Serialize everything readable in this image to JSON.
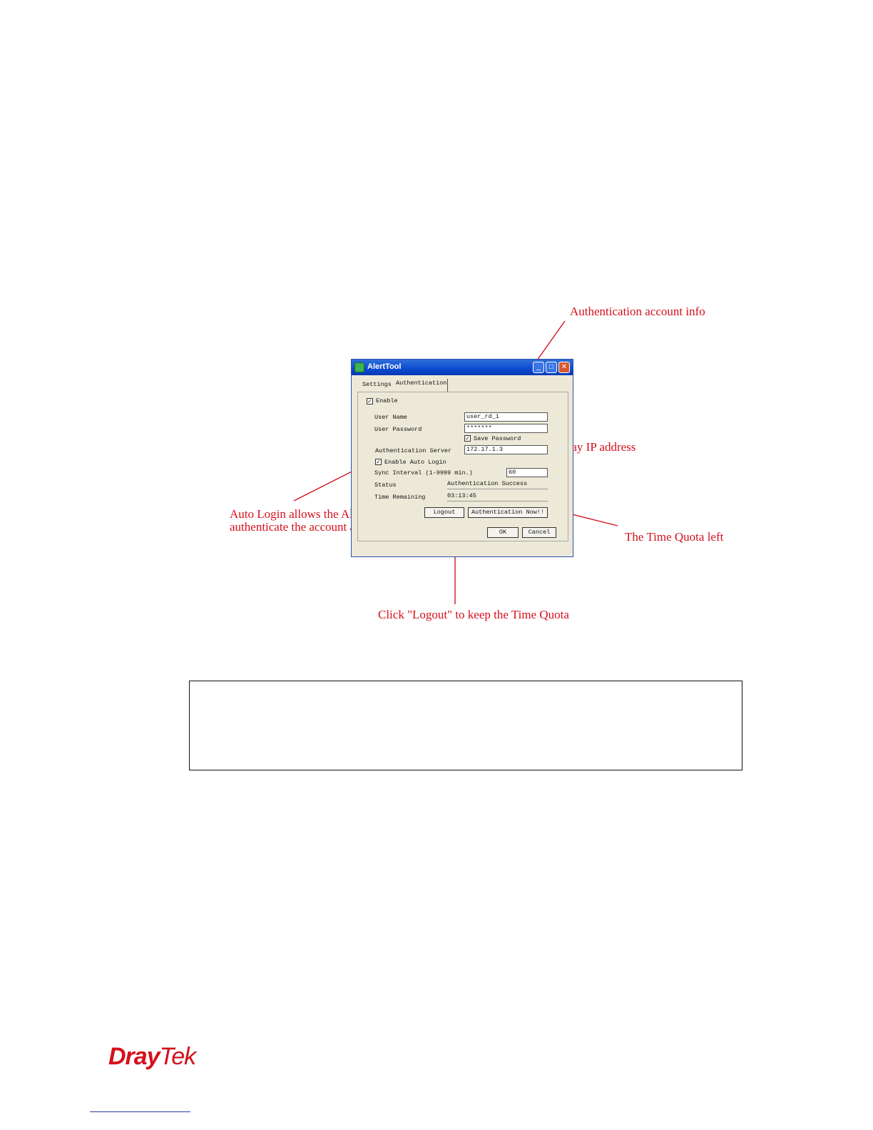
{
  "window": {
    "title": "AlertTool",
    "tabs": [
      "Settings",
      "Authentication"
    ],
    "enable_label": "Enable",
    "user_name_label": "User Name",
    "user_name_value": "user_rd_1",
    "user_password_label": "User Password",
    "user_password_value": "*******",
    "save_password_label": "Save Password",
    "auth_server_label": "Authentication Server",
    "auth_server_value": "172.17.1.3",
    "auto_login_label": "Enable Auto Login",
    "sync_interval_label": "Sync Interval (1-9999 min.)",
    "sync_interval_value": "60",
    "status_label": "Status",
    "status_value": "Authentication Success",
    "time_remaining_label": "Time Remaining",
    "time_remaining_value": "03:13:45",
    "logout_button": "Logout",
    "auth_now_button": "Authentication Now!!",
    "ok_button": "OK",
    "cancel_button": "Cancel"
  },
  "annotations": {
    "account_info": "Authentication account info",
    "gateway_ip": "Gateway IP address",
    "auto_login_line1": "Auto Login allows the Alter Tool to",
    "auto_login_line2": "authenticate the account automatically",
    "time_quota": "The Time Quota left",
    "logout_hint": "Click \"Logout\" to keep the Time Quota"
  },
  "footer": {
    "logo_dray": "Dray",
    "logo_tek": "Tek"
  },
  "colors": {
    "annotation": "#d4101c",
    "titlebar": "#0a4bd0",
    "logo": "#d4101c"
  }
}
